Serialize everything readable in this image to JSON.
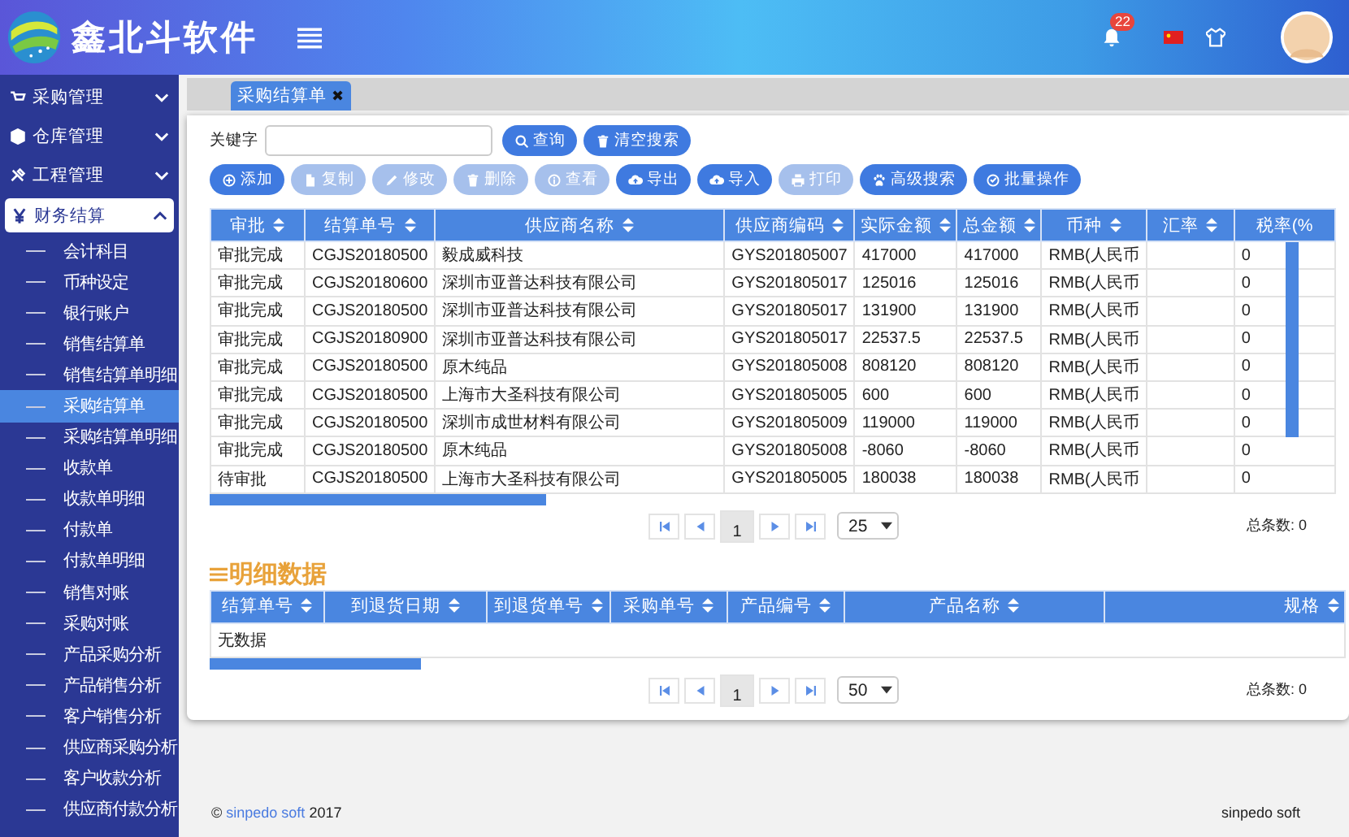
{
  "header": {
    "brand": "鑫北斗软件",
    "notification_count": "22"
  },
  "sidebar": {
    "items": [
      {
        "label": "采购管理",
        "expanded": false
      },
      {
        "label": "仓库管理",
        "expanded": false
      },
      {
        "label": "工程管理",
        "expanded": false
      },
      {
        "label": "财务结算",
        "expanded": true,
        "children": [
          {
            "label": "会计科目",
            "selected": false
          },
          {
            "label": "币种设定",
            "selected": false
          },
          {
            "label": "银行账户",
            "selected": false
          },
          {
            "label": "销售结算单",
            "selected": false
          },
          {
            "label": "销售结算单明细",
            "selected": false
          },
          {
            "label": "采购结算单",
            "selected": true
          },
          {
            "label": "采购结算单明细",
            "selected": false
          },
          {
            "label": "收款单",
            "selected": false
          },
          {
            "label": "收款单明细",
            "selected": false
          },
          {
            "label": "付款单",
            "selected": false
          },
          {
            "label": "付款单明细",
            "selected": false
          },
          {
            "label": "销售对账",
            "selected": false
          },
          {
            "label": "采购对账",
            "selected": false
          },
          {
            "label": "产品采购分析",
            "selected": false
          },
          {
            "label": "产品销售分析",
            "selected": false
          },
          {
            "label": "客户销售分析",
            "selected": false
          },
          {
            "label": "供应商采购分析",
            "selected": false
          },
          {
            "label": "客户收款分析",
            "selected": false
          },
          {
            "label": "供应商付款分析",
            "selected": false
          }
        ]
      }
    ]
  },
  "tabs": [
    {
      "label": "采购结算单",
      "close": "✖",
      "selected": true
    }
  ],
  "search": {
    "label": "关键字",
    "buttons": [
      {
        "label": "查询"
      },
      {
        "label": "清空搜索"
      }
    ]
  },
  "toolbar": [
    {
      "label": "添加",
      "disabled": false
    },
    {
      "label": "复制",
      "disabled": true
    },
    {
      "label": "修改",
      "disabled": true
    },
    {
      "label": "删除",
      "disabled": true
    },
    {
      "label": "查看",
      "disabled": true
    },
    {
      "label": "导出",
      "disabled": false
    },
    {
      "label": "导入",
      "disabled": false
    },
    {
      "label": "打印",
      "disabled": true
    },
    {
      "label": "高级搜索",
      "disabled": false
    },
    {
      "label": "批量操作",
      "disabled": false
    }
  ],
  "table": {
    "columns": [
      "审批",
      "结算单号",
      "供应商名称",
      "供应商编码",
      "实际金额",
      "总金额",
      "币种",
      "汇率",
      "税率(%"
    ],
    "rows": [
      [
        "审批完成",
        "CGJS20180500",
        "毅成威科技",
        "GYS201805007",
        "417000",
        "417000",
        "RMB(人民币",
        "",
        "0"
      ],
      [
        "审批完成",
        "CGJS20180600",
        "深圳市亚普达科技有限公司",
        "GYS201805017",
        "125016",
        "125016",
        "RMB(人民币",
        "",
        "0"
      ],
      [
        "审批完成",
        "CGJS20180500",
        "深圳市亚普达科技有限公司",
        "GYS201805017",
        "131900",
        "131900",
        "RMB(人民币",
        "",
        "0"
      ],
      [
        "审批完成",
        "CGJS20180900",
        "深圳市亚普达科技有限公司",
        "GYS201805017",
        "22537.5",
        "22537.5",
        "RMB(人民币",
        "",
        "0"
      ],
      [
        "审批完成",
        "CGJS20180500",
        "原木纯品",
        "GYS201805008",
        "808120",
        "808120",
        "RMB(人民币",
        "",
        "0"
      ],
      [
        "审批完成",
        "CGJS20180500",
        "上海市大圣科技有限公司",
        "GYS201805005",
        "600",
        "600",
        "RMB(人民币",
        "",
        "0"
      ],
      [
        "审批完成",
        "CGJS20180500",
        "深圳市成世材料有限公司",
        "GYS201805009",
        "119000",
        "119000",
        "RMB(人民币",
        "",
        "0"
      ],
      [
        "审批完成",
        "CGJS20180500",
        "原木纯品",
        "GYS201805008",
        "-8060",
        "-8060",
        "RMB(人民币",
        "",
        "0"
      ],
      [
        "待审批",
        "CGJS20180500",
        "上海市大圣科技有限公司",
        "GYS201805005",
        "180038",
        "180038",
        "RMB(人民币",
        "",
        "0"
      ]
    ]
  },
  "pager": {
    "page": "1",
    "page_size": "25",
    "total": "总条数: 0"
  },
  "detail": {
    "title": "明细数据",
    "columns": [
      "结算单号",
      "到退货日期",
      "到退货单号",
      "采购单号",
      "产品编号",
      "产品名称",
      "规格"
    ],
    "empty": "无数据",
    "pager": {
      "page": "1",
      "page_size": "50",
      "total": "总条数: 0"
    }
  },
  "footer": {
    "copyright": "©",
    "link": "sinpedo soft",
    "year": "2017",
    "right": "sinpedo soft"
  }
}
